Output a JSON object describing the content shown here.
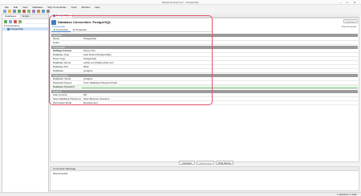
{
  "title_bar": {
    "title": "Relational Data Tool – PostgreSQL"
  },
  "menu": [
    "File",
    "Edit",
    "View",
    "Database",
    "SQL Commander",
    "Tools",
    "Window",
    "Help"
  ],
  "left_panel": {
    "tab_databases": "Databases",
    "tab_scripts": "Scripts",
    "tree_root": "Connections",
    "tree_child": "PostgreSQL"
  },
  "editor_tab": "PostgreSQL",
  "header": {
    "title": "Database Connection: PostgreSQL",
    "subtitle": "PostgreSQL",
    "right_button": "Connect",
    "status": "Disconnected"
  },
  "subtabs": {
    "connection": "Connection",
    "properties": "Properties"
  },
  "sections": [
    {
      "name": "General",
      "rows": [
        {
          "k": "Name",
          "v": "PostgreSQL"
        },
        {
          "k": "Notes",
          "v": ""
        }
      ]
    },
    {
      "name": "Connection",
      "rows": [
        {
          "k": "Settings Format",
          "v": "Server Info"
        },
        {
          "k": "Database Type",
          "v": "Auto Detect (PostgreSQL)"
        },
        {
          "k": "Driver Type",
          "v": "PostgreSQL"
        },
        {
          "k": "Database Server",
          "v": "cobbs.xxx.dl.dbprovider.com"
        },
        {
          "k": "Database Port",
          "v": "5432"
        },
        {
          "k": "Database",
          "v": "postgres"
        }
      ]
    },
    {
      "name": "Authentication",
      "rows": [
        {
          "k": "Database Userid",
          "v": "postgres"
        },
        {
          "k": "Password Source",
          "v": "From Database Password Field"
        },
        {
          "k": "Database Password",
          "v": ""
        }
      ]
    },
    {
      "name": "Options",
      "rows": [
        {
          "k": "Auto Commit",
          "v": "Off"
        },
        {
          "k": "Save Database Password",
          "v": "Save Between Sessions"
        },
        {
          "k": "Permission Mode",
          "v": "Development"
        }
      ]
    }
  ],
  "bottom_buttons": {
    "connect": "Connect",
    "disconnect": "Disconnect",
    "ping": "Ping Server"
  },
  "messages": {
    "title": "Connection Message",
    "text": "Disconnected"
  },
  "status_bar": {
    "text": "1 selected / 1 total"
  },
  "colors": {
    "highlight_border": "#e0526a",
    "section_bg": "#9a9a9a",
    "selection": "#cfe3f7"
  }
}
